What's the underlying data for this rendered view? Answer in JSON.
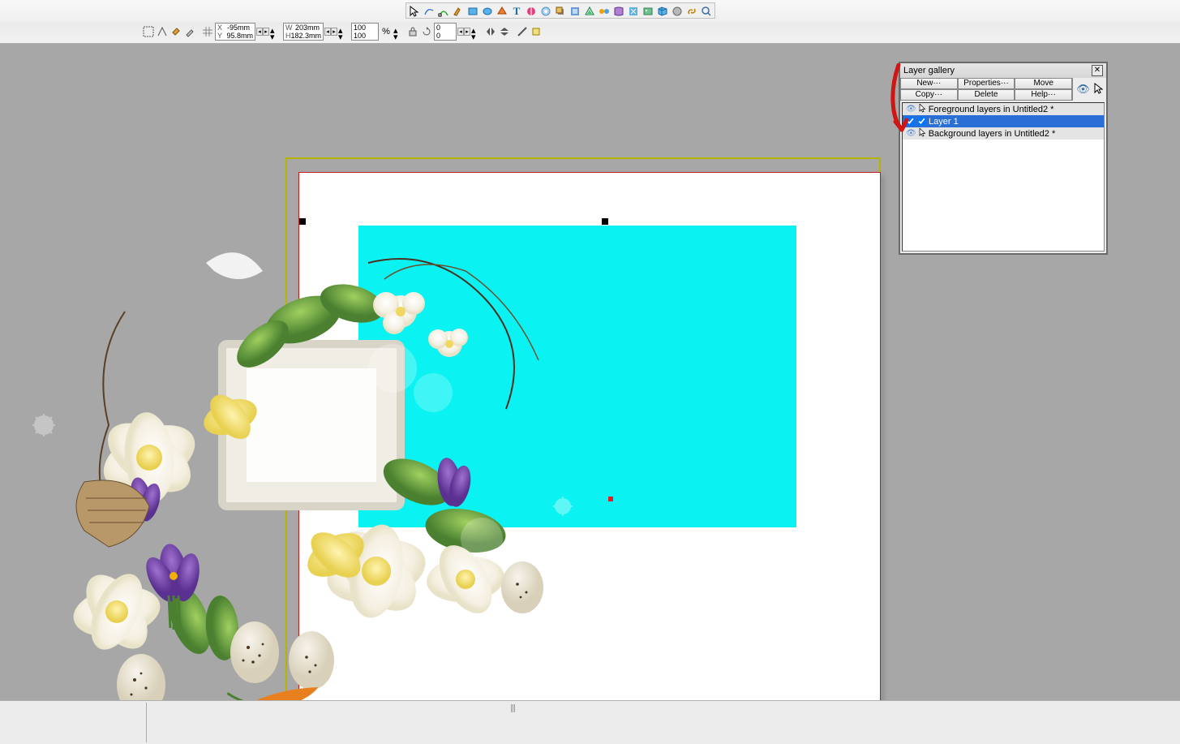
{
  "coords": {
    "X": "-95mm",
    "Y": "95.8mm",
    "W": "203mm",
    "H": "182.3mm",
    "scaleW": "100",
    "scaleH": "100",
    "rotate": "0",
    "skew": "0"
  },
  "layer_gallery": {
    "title": "Layer gallery",
    "buttons": {
      "new": "New···",
      "properties": "Properties···",
      "move": "Move",
      "copy": "Copy···",
      "delete": "Delete",
      "help": "Help···"
    },
    "rows": {
      "fg_heading": "Foreground layers in Untitled2 *",
      "layer1": "Layer 1",
      "bg_heading": "Background layers in Untitled2 *"
    }
  }
}
